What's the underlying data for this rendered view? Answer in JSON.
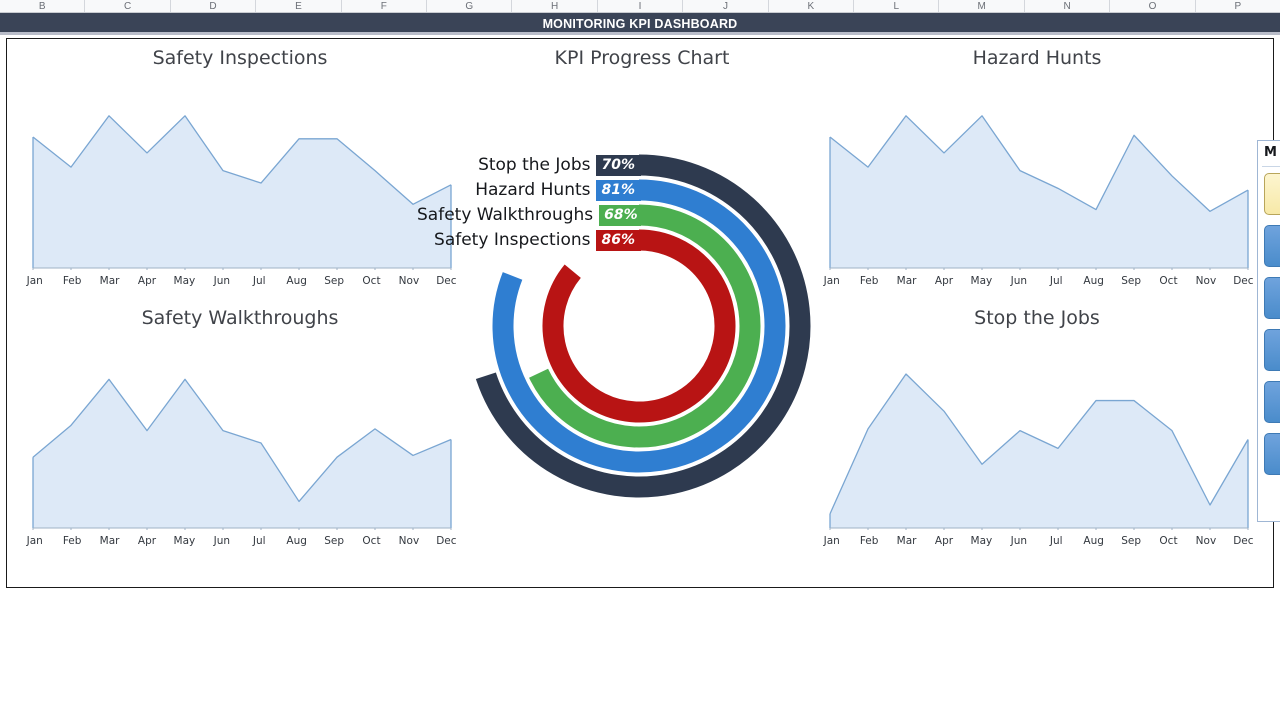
{
  "spreadsheet": {
    "column_headers": [
      "B",
      "C",
      "D",
      "E",
      "F",
      "G",
      "H",
      "I",
      "J",
      "K",
      "L",
      "M",
      "N",
      "O",
      "P"
    ]
  },
  "header": {
    "title": "MONITORING KPI DASHBOARD",
    "bar_color": "#3a4457"
  },
  "side_panel": {
    "title": "M",
    "buttons": [
      "",
      "",
      "",
      "",
      "",
      ""
    ]
  },
  "kpi": {
    "title": "KPI Progress Chart",
    "rows": [
      {
        "label": "Stop the Jobs",
        "value": "70%",
        "percent": 70,
        "color": "#2e3a4f"
      },
      {
        "label": "Hazard Hunts",
        "value": "81%",
        "percent": 81,
        "color": "#2f7ed1"
      },
      {
        "label": "Safety Walkthroughs",
        "value": "68%",
        "percent": 68,
        "color": "#4caf50"
      },
      {
        "label": "Safety Inspections",
        "value": "86%",
        "percent": 86,
        "color": "#b81414"
      }
    ]
  },
  "chart_data": [
    {
      "type": "area",
      "title": "Safety Inspections",
      "xlabel": "",
      "ylabel": "",
      "grid": false,
      "legend": "none",
      "ylim": [
        0,
        100
      ],
      "categories": [
        "Jan",
        "Feb",
        "Mar",
        "Apr",
        "May",
        "Jun",
        "Jul",
        "Aug",
        "Sep",
        "Oct",
        "Nov",
        "Dec"
      ],
      "values": [
        74,
        57,
        86,
        65,
        86,
        55,
        48,
        73,
        73,
        55,
        36,
        47
      ],
      "line_color": "#7aa6d2",
      "fill_color": "#dde9f7"
    },
    {
      "type": "area",
      "title": "Hazard Hunts",
      "xlabel": "",
      "ylabel": "",
      "grid": false,
      "legend": "none",
      "ylim": [
        0,
        100
      ],
      "categories": [
        "Jan",
        "Feb",
        "Mar",
        "Apr",
        "May",
        "Jun",
        "Jul",
        "Aug",
        "Sep",
        "Oct",
        "Nov",
        "Dec"
      ],
      "values": [
        74,
        57,
        86,
        65,
        86,
        55,
        45,
        33,
        75,
        52,
        32,
        44
      ],
      "line_color": "#7aa6d2",
      "fill_color": "#dde9f7"
    },
    {
      "type": "area",
      "title": "Safety Walkthroughs",
      "xlabel": "",
      "ylabel": "",
      "grid": false,
      "legend": "none",
      "ylim": [
        0,
        100
      ],
      "categories": [
        "Jan",
        "Feb",
        "Mar",
        "Apr",
        "May",
        "Jun",
        "Jul",
        "Aug",
        "Sep",
        "Oct",
        "Nov",
        "Dec"
      ],
      "values": [
        40,
        58,
        84,
        55,
        84,
        55,
        48,
        15,
        40,
        56,
        41,
        50
      ],
      "line_color": "#7aa6d2",
      "fill_color": "#dde9f7"
    },
    {
      "type": "area",
      "title": "Stop the Jobs",
      "xlabel": "",
      "ylabel": "",
      "grid": false,
      "legend": "none",
      "ylim": [
        0,
        100
      ],
      "categories": [
        "Jan",
        "Feb",
        "Mar",
        "Apr",
        "May",
        "Jun",
        "Jul",
        "Aug",
        "Sep",
        "Oct",
        "Nov",
        "Dec"
      ],
      "values": [
        8,
        56,
        87,
        66,
        36,
        55,
        45,
        72,
        72,
        55,
        13,
        50
      ],
      "line_color": "#7aa6d2",
      "fill_color": "#dde9f7"
    }
  ]
}
